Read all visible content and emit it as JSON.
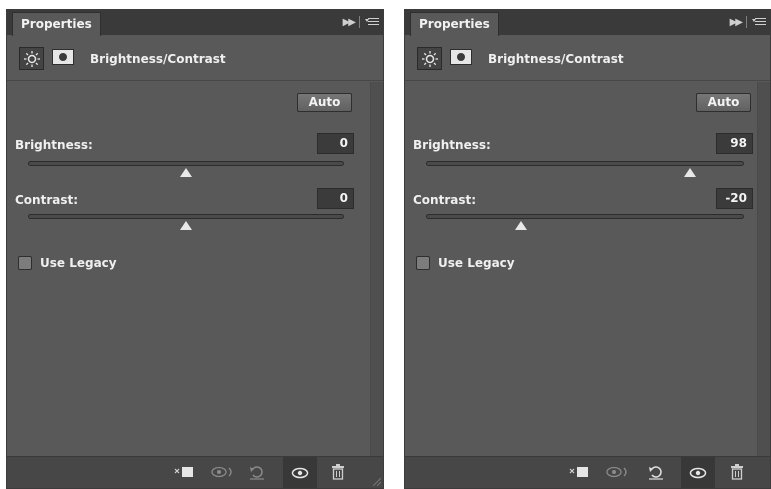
{
  "panels": [
    {
      "tab_title": "Properties",
      "adjustment_title": "Brightness/Contrast",
      "auto_label": "Auto",
      "brightness": {
        "label": "Brightness:",
        "value": "0",
        "position": 0.5
      },
      "contrast": {
        "label": "Contrast:",
        "value": "0",
        "position": 0.5
      },
      "use_legacy": {
        "label": "Use Legacy",
        "checked": false
      }
    },
    {
      "tab_title": "Properties",
      "adjustment_title": "Brightness/Contrast",
      "auto_label": "Auto",
      "brightness": {
        "label": "Brightness:",
        "value": "98",
        "position": 0.83
      },
      "contrast": {
        "label": "Contrast:",
        "value": "-20",
        "position": 0.3
      },
      "use_legacy": {
        "label": "Use Legacy",
        "checked": false
      }
    }
  ],
  "icons": {
    "adjustment": "brightness-sun-icon",
    "mask": "layer-mask-icon",
    "collapse": "double-chevron-icon",
    "panel_menu": "panel-menu-icon",
    "clip": "clip-to-layer-icon",
    "view_previous": "view-previous-state-icon",
    "reset": "reset-icon",
    "visibility": "eye-icon",
    "delete": "trash-icon"
  },
  "colors": {
    "panel_bg": "#595959",
    "tab_bar": "#3a3a3a",
    "field_bg": "#3b3b3b",
    "text": "#f0f0f0"
  }
}
